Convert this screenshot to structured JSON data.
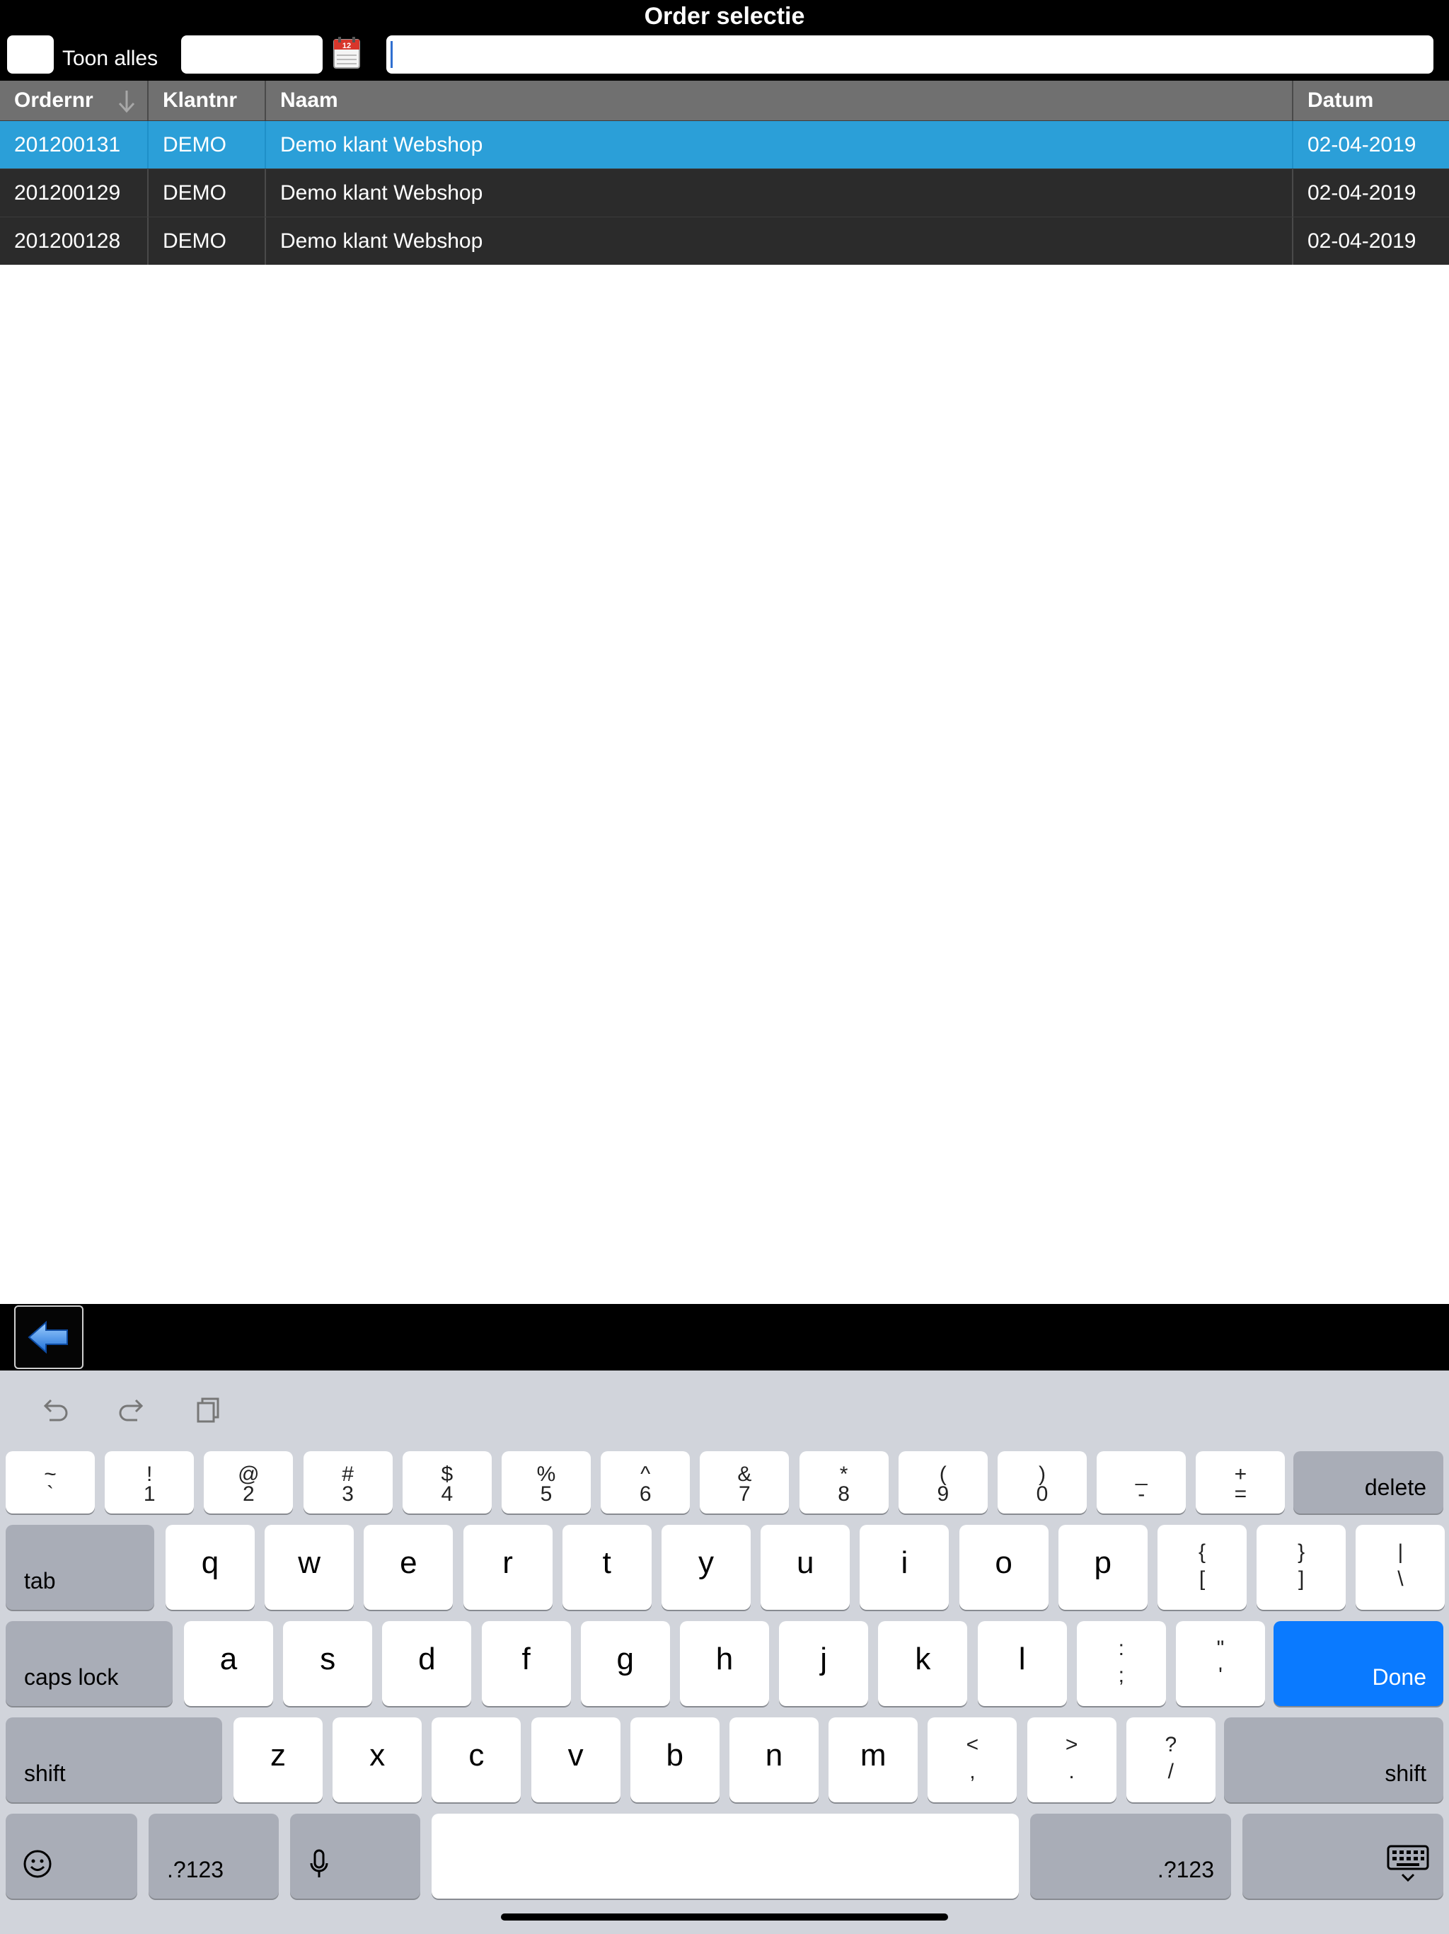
{
  "app": {
    "title": "Order selectie"
  },
  "toolbar": {
    "toggle_label": "Toon alles",
    "date_value": "",
    "search_value": ""
  },
  "table": {
    "columns": [
      "Ordernr",
      "Klantnr",
      "Naam",
      "Datum"
    ],
    "sort_indicator": "descending",
    "rows": [
      {
        "ordernr": "201200131",
        "klantnr": "DEMO",
        "naam": "Demo klant Webshop",
        "datum": "02-04-2019",
        "selected": true
      },
      {
        "ordernr": "201200129",
        "klantnr": "DEMO",
        "naam": "Demo klant Webshop",
        "datum": "02-04-2019",
        "selected": false
      },
      {
        "ordernr": "201200128",
        "klantnr": "DEMO",
        "naam": "Demo klant Webshop",
        "datum": "02-04-2019",
        "selected": false
      }
    ]
  },
  "accessory": {
    "back_icon": "arrow-left-icon"
  },
  "keyboard": {
    "shortcuts": [
      "undo-icon",
      "redo-icon",
      "paste-icon"
    ],
    "number_row": [
      {
        "top": "~",
        "bot": "`"
      },
      {
        "top": "!",
        "bot": "1"
      },
      {
        "top": "@",
        "bot": "2"
      },
      {
        "top": "#",
        "bot": "3"
      },
      {
        "top": "$",
        "bot": "4"
      },
      {
        "top": "%",
        "bot": "5"
      },
      {
        "top": "^",
        "bot": "6"
      },
      {
        "top": "&",
        "bot": "7"
      },
      {
        "top": "*",
        "bot": "8"
      },
      {
        "top": "(",
        "bot": "9"
      },
      {
        "top": ")",
        "bot": "0"
      },
      {
        "top": "_",
        "bot": "-"
      },
      {
        "top": "+",
        "bot": "="
      }
    ],
    "delete": "delete",
    "tab": "tab",
    "row_q": [
      "q",
      "w",
      "e",
      "r",
      "t",
      "y",
      "u",
      "i",
      "o",
      "p"
    ],
    "row_q_sym": [
      {
        "top": "{",
        "bot": "["
      },
      {
        "top": "}",
        "bot": "]"
      },
      {
        "top": "|",
        "bot": "\\"
      }
    ],
    "caps": "caps lock",
    "row_a": [
      "a",
      "s",
      "d",
      "f",
      "g",
      "h",
      "j",
      "k",
      "l"
    ],
    "row_a_sym": [
      {
        "top": ":",
        "bot": ";"
      },
      {
        "top": "\"",
        "bot": "'"
      }
    ],
    "done": "Done",
    "shift": "shift",
    "row_z": [
      "z",
      "x",
      "c",
      "v",
      "b",
      "n",
      "m"
    ],
    "row_z_sym": [
      {
        "top": "<",
        "bot": ","
      },
      {
        "top": ">",
        "bot": "."
      },
      {
        "top": "?",
        "bot": "/"
      }
    ],
    "numbers_label": ".?123",
    "emoji_icon": "emoji-icon",
    "mic_icon": "microphone-icon",
    "dismiss_icon": "keyboard-dismiss-icon"
  },
  "colors": {
    "selected_row": "#2b9fd8",
    "row_bg": "#2b2b2b",
    "header_bg": "#707070",
    "done_key": "#0a7aff"
  }
}
